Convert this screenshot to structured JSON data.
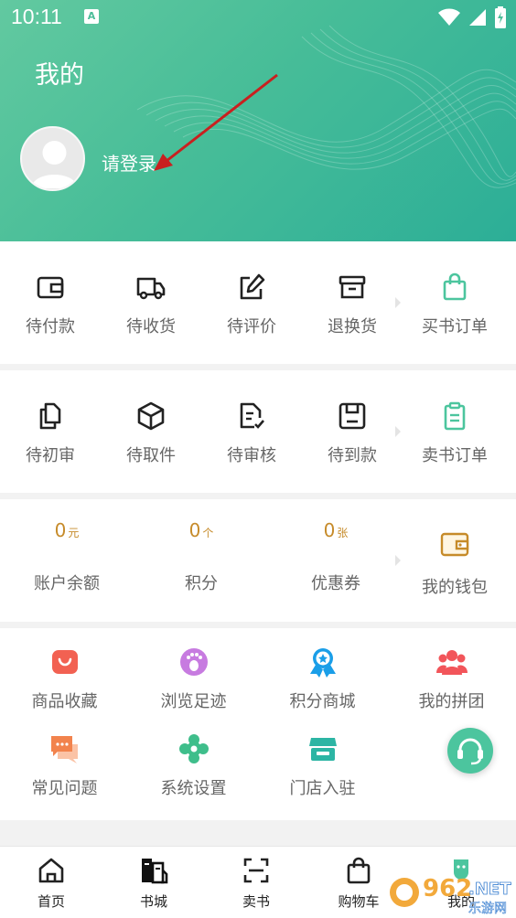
{
  "status_bar": {
    "time": "10:11",
    "a_label": "A"
  },
  "header": {
    "title": "我的",
    "login_text": "请登录"
  },
  "orders": [
    {
      "label": "待付款",
      "icon": "wallet-icon"
    },
    {
      "label": "待收货",
      "icon": "truck-icon"
    },
    {
      "label": "待评价",
      "icon": "edit-icon"
    },
    {
      "label": "退换货",
      "icon": "return-box-icon"
    },
    {
      "label": "买书订单",
      "icon": "shopping-bag-icon"
    }
  ],
  "sell_orders": [
    {
      "label": "待初审",
      "icon": "copy-icon"
    },
    {
      "label": "待取件",
      "icon": "package-icon"
    },
    {
      "label": "待审核",
      "icon": "document-check-icon"
    },
    {
      "label": "待到款",
      "icon": "save-icon"
    },
    {
      "label": "卖书订单",
      "icon": "clipboard-icon"
    }
  ],
  "assets": [
    {
      "value": "0",
      "unit": "元",
      "label": "账户余额"
    },
    {
      "value": "0",
      "unit": "个",
      "label": "积分"
    },
    {
      "value": "0",
      "unit": "张",
      "label": "优惠券"
    }
  ],
  "wallet": {
    "label": "我的钱包",
    "icon": "wallet-icon"
  },
  "services": [
    {
      "label": "商品收藏",
      "icon": "favorites-bag-icon",
      "color": "#f26152"
    },
    {
      "label": "浏览足迹",
      "icon": "footprint-icon",
      "color": "#c77be0"
    },
    {
      "label": "积分商城",
      "icon": "medal-icon",
      "color": "#1a9ee8"
    },
    {
      "label": "我的拼团",
      "icon": "group-icon",
      "color": "#f2555a"
    },
    {
      "label": "常见问题",
      "icon": "chat-bubbles-icon",
      "color": "#f2834d"
    },
    {
      "label": "系统设置",
      "icon": "flower-settings-icon",
      "color": "#3fbe8b"
    },
    {
      "label": "门店入驻",
      "icon": "store-icon",
      "color": "#2cb5a4"
    }
  ],
  "tabbar": [
    {
      "label": "首页",
      "icon": "home-icon"
    },
    {
      "label": "书城",
      "icon": "books-icon"
    },
    {
      "label": "卖书",
      "icon": "scan-icon"
    },
    {
      "label": "购物车",
      "icon": "cart-bag-icon"
    },
    {
      "label": "我的",
      "icon": "profile-icon"
    }
  ],
  "colors": {
    "accent": "#4cc59e",
    "amount": "#c68b2a"
  }
}
